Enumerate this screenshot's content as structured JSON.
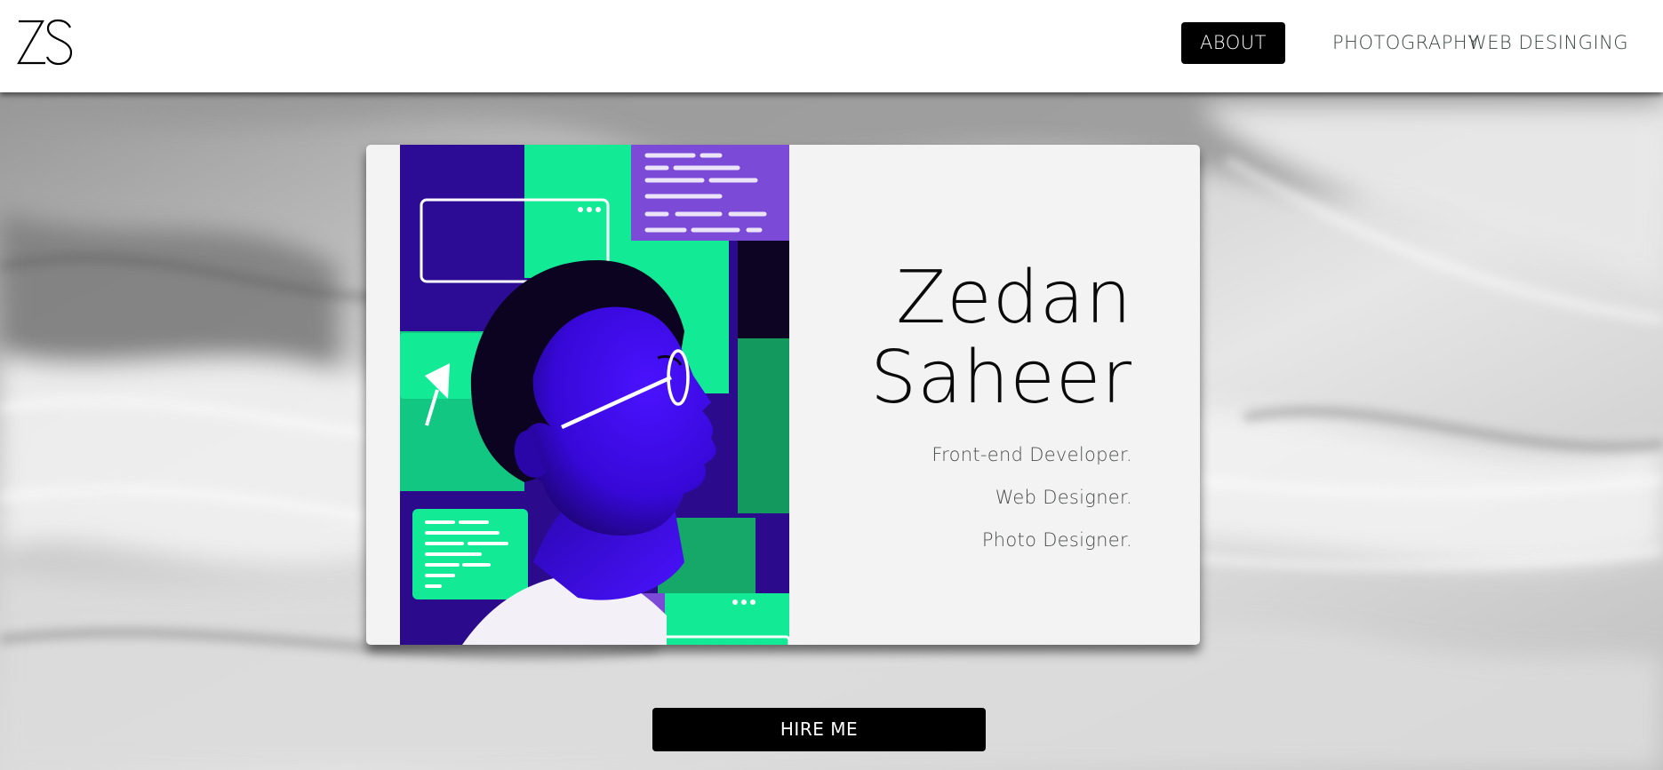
{
  "header": {
    "logo_text": "ZS",
    "nav": [
      {
        "label": "ABOUT",
        "active": true
      },
      {
        "label": "PHOTOGRAPHY",
        "active": false
      },
      {
        "label": "WEB DESINGING",
        "active": false
      }
    ]
  },
  "hero": {
    "first_name": "Zedan",
    "last_name": "Saheer",
    "roles": [
      "Front-end Developer.",
      "Web Designer.",
      "Photo Designer."
    ],
    "illustration_icon": "developer-profile-illustration",
    "background_icon": "marble-wave-background"
  },
  "cta": {
    "label": "HIRE ME"
  },
  "colors": {
    "header_bg": "#ffffff",
    "active_nav_bg": "#000000",
    "illustration_purple": "#3a0ee0",
    "illustration_green": "#12ea96",
    "card_bg": "#f3f3f3"
  }
}
